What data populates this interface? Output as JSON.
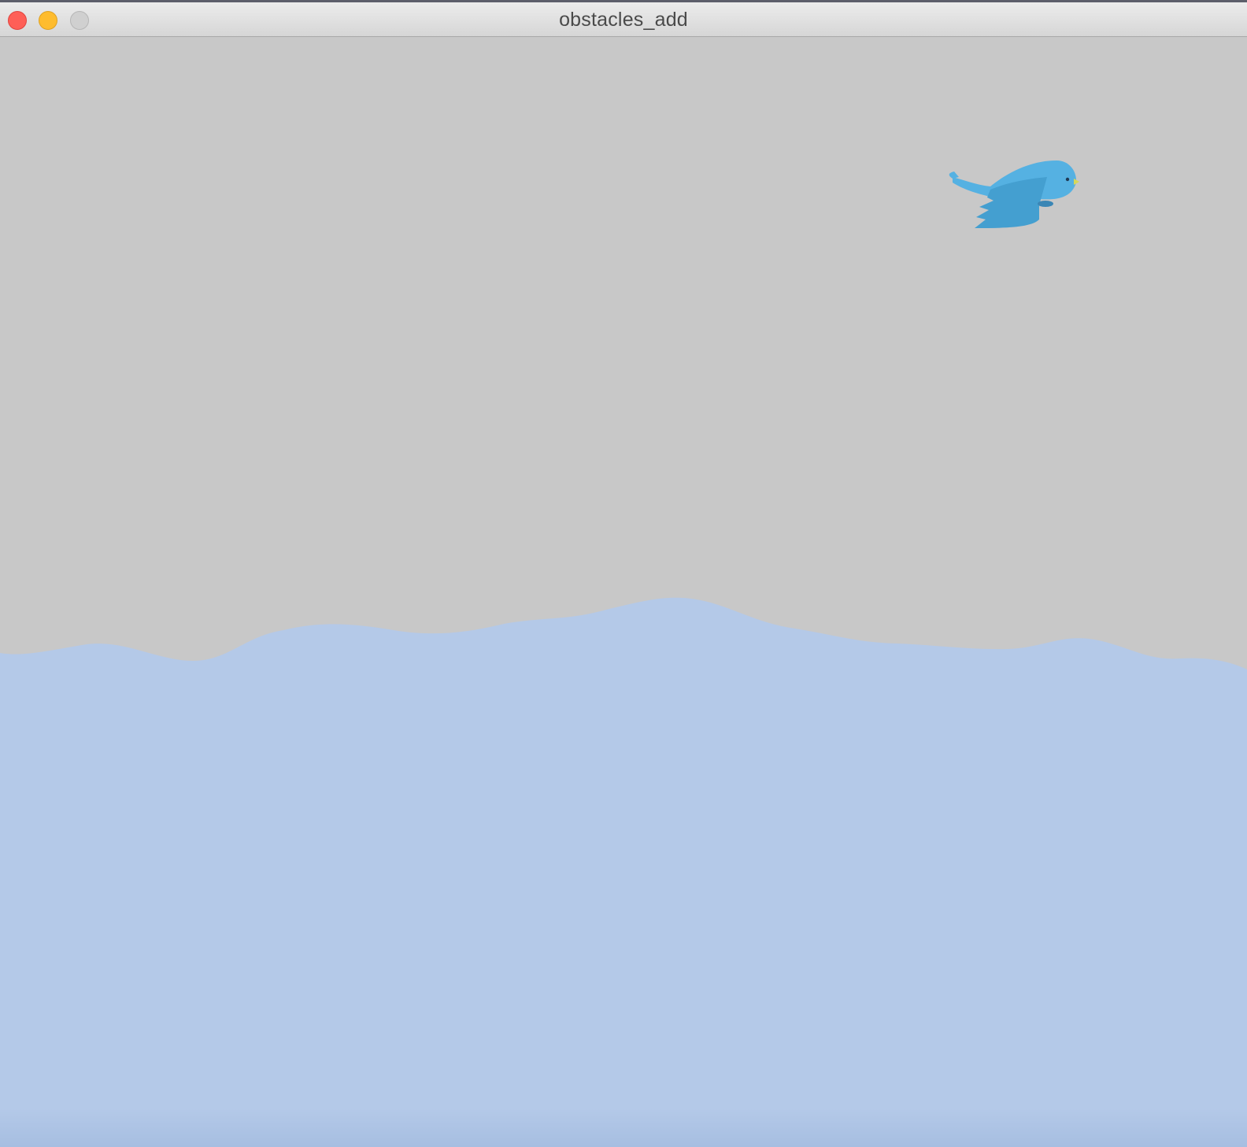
{
  "window": {
    "title": "obstacles_add",
    "buttons": {
      "close": "close-icon",
      "minimize": "minimize-icon",
      "zoom": "zoom-icon"
    }
  },
  "scene": {
    "sky_color": "#c8c8c8",
    "water_color": "#b4c9e8",
    "bird_color": "#55b1e2",
    "bird_wing_color": "#449fd0",
    "bird_beak_color": "#d8d858"
  }
}
